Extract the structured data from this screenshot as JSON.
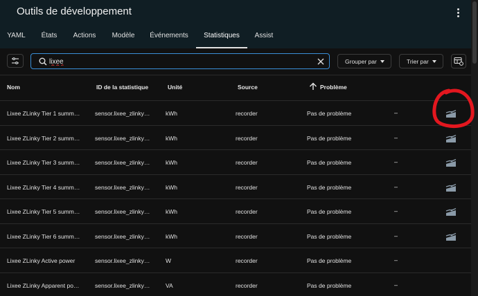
{
  "header": {
    "title": "Outils de développement",
    "tabs": [
      {
        "label": "YAML",
        "active": false
      },
      {
        "label": "États",
        "active": false
      },
      {
        "label": "Actions",
        "active": false
      },
      {
        "label": "Modèle",
        "active": false
      },
      {
        "label": "Événements",
        "active": false
      },
      {
        "label": "Statistiques",
        "active": true
      },
      {
        "label": "Assist",
        "active": false
      }
    ]
  },
  "toolbar": {
    "search_value": "lixee",
    "group_by_label": "Grouper par",
    "sort_by_label": "Trier par"
  },
  "table": {
    "columns": [
      "Nom",
      "ID de la statistique",
      "Unité",
      "Source",
      "Problème"
    ],
    "rows": [
      {
        "name": "Lixee ZLinky Tier 1 summ…",
        "id": "sensor.lixee_zlinky…",
        "unit": "kWh",
        "source": "recorder",
        "issue": "Pas de problème",
        "extra": "–",
        "has_adjust": true
      },
      {
        "name": "Lixee ZLinky Tier 2 summ…",
        "id": "sensor.lixee_zlinky…",
        "unit": "kWh",
        "source": "recorder",
        "issue": "Pas de problème",
        "extra": "–",
        "has_adjust": true
      },
      {
        "name": "Lixee ZLinky Tier 3 summ…",
        "id": "sensor.lixee_zlinky…",
        "unit": "kWh",
        "source": "recorder",
        "issue": "Pas de problème",
        "extra": "–",
        "has_adjust": true
      },
      {
        "name": "Lixee ZLinky Tier 4 summ…",
        "id": "sensor.lixee_zlinky…",
        "unit": "kWh",
        "source": "recorder",
        "issue": "Pas de problème",
        "extra": "–",
        "has_adjust": true
      },
      {
        "name": "Lixee ZLinky Tier 5 summ…",
        "id": "sensor.lixee_zlinky…",
        "unit": "kWh",
        "source": "recorder",
        "issue": "Pas de problème",
        "extra": "–",
        "has_adjust": true
      },
      {
        "name": "Lixee ZLinky Tier 6 summ…",
        "id": "sensor.lixee_zlinky…",
        "unit": "kWh",
        "source": "recorder",
        "issue": "Pas de problème",
        "extra": "–",
        "has_adjust": true
      },
      {
        "name": "Lixee ZLinky Active power",
        "id": "sensor.lixee_zlinky…",
        "unit": "W",
        "source": "recorder",
        "issue": "Pas de problème",
        "extra": "–",
        "has_adjust": false
      },
      {
        "name": "Lixee ZLinky Apparent po…",
        "id": "sensor.lixee_zlinky…",
        "unit": "VA",
        "source": "recorder",
        "issue": "Pas de problème",
        "extra": "–",
        "has_adjust": false
      }
    ]
  },
  "icons": {
    "more": "more-vertical-icon",
    "filter": "filter-list-icon",
    "search": "search-icon",
    "clear": "close-icon",
    "settings": "table-settings-icon",
    "sort": "arrow-up-icon",
    "adjust": "chart-adjust-icon"
  },
  "colors": {
    "header_bg": "#101e24",
    "page_bg": "#111111",
    "search_border": "#3a8fd8",
    "annotation": "#e3171f",
    "adjust_icon": "#8a9aa8"
  }
}
